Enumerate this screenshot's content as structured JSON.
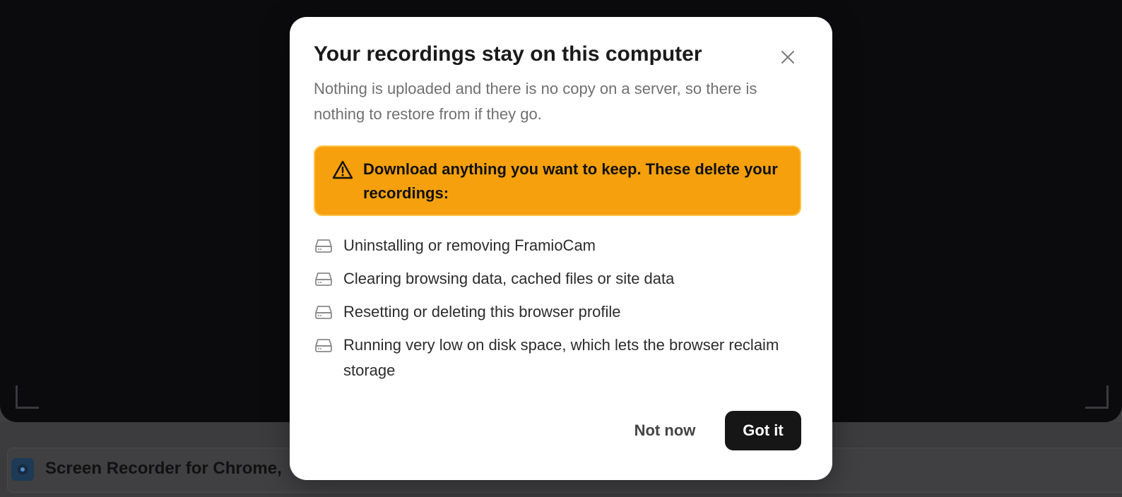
{
  "background": {
    "tab_title": "Screen Recorder for Chrome,"
  },
  "dialog": {
    "title": "Your recordings stay on this computer",
    "subtitle": "Nothing is uploaded and there is no copy on a server, so there is nothing to restore from if they go.",
    "warning": {
      "icon": "warning-triangle-icon",
      "text": "Download anything you want to keep. These delete your recordings:",
      "background_color": "#f5a00c"
    },
    "items": [
      {
        "icon": "drive-icon",
        "text": "Uninstalling or removing FramioCam"
      },
      {
        "icon": "drive-icon",
        "text": "Clearing browsing data, cached files or site data"
      },
      {
        "icon": "drive-icon",
        "text": "Resetting or deleting this browser profile"
      },
      {
        "icon": "drive-icon",
        "text": "Running very low on disk space, which lets the browser reclaim storage"
      }
    ],
    "buttons": {
      "secondary_label": "Not now",
      "primary_label": "Got it"
    },
    "close_icon": "close-icon"
  }
}
